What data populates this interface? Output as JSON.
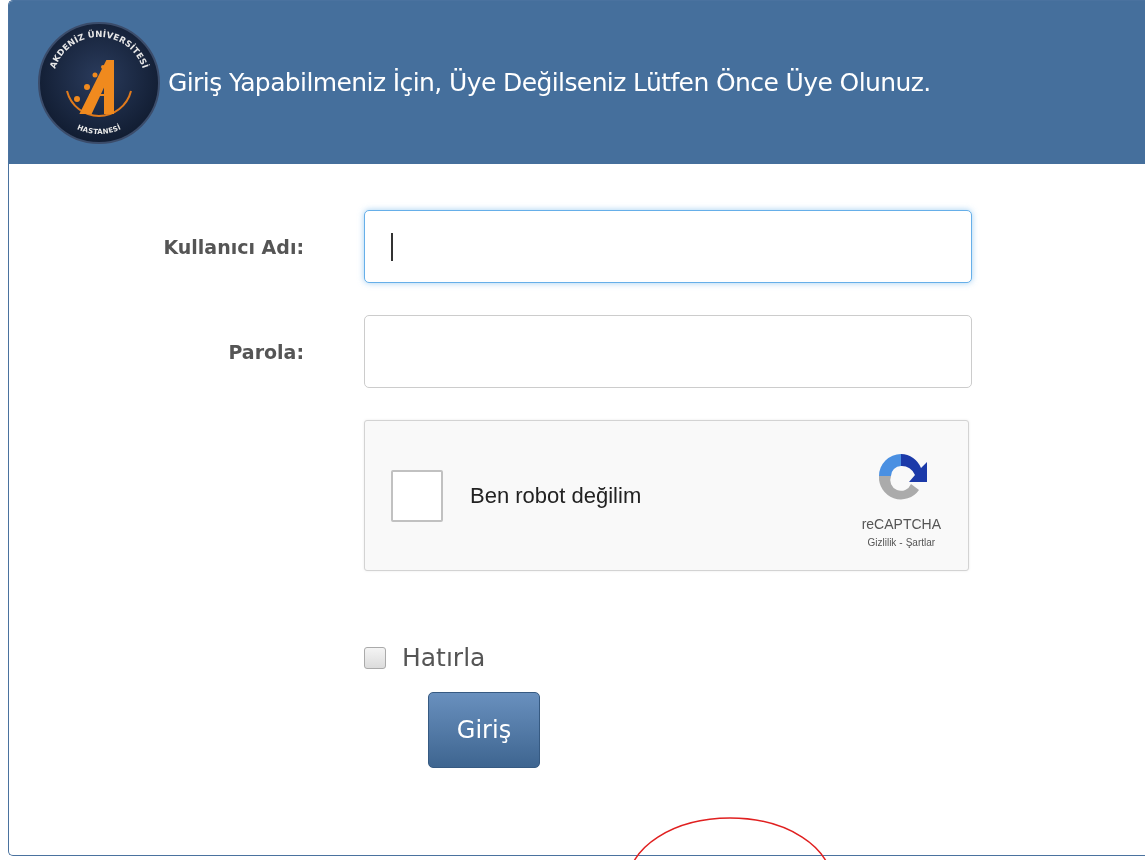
{
  "header": {
    "logo": {
      "top_text": "AKDENİZ ÜNİVERSİTESİ",
      "bottom_text": "HASTANESİ"
    },
    "title": "Giriş Yapabilmeniz İçin, Üye Değilseniz Lütfen Önce Üye Olunuz."
  },
  "fields": [
    {
      "label": "Kullanıcı Adı:",
      "focused": true
    },
    {
      "label": "Parola:",
      "focused": false
    }
  ],
  "captcha": {
    "label": "Ben robot değilim",
    "checked": false,
    "brand": "reCAPTCHA",
    "links": [
      {
        "text": "Gizlilik"
      },
      {
        "text": "Şartlar"
      }
    ],
    "separator": "-"
  },
  "remember": {
    "label": "Hatırla",
    "checked": false
  },
  "submit": {
    "label": "Giriş"
  }
}
